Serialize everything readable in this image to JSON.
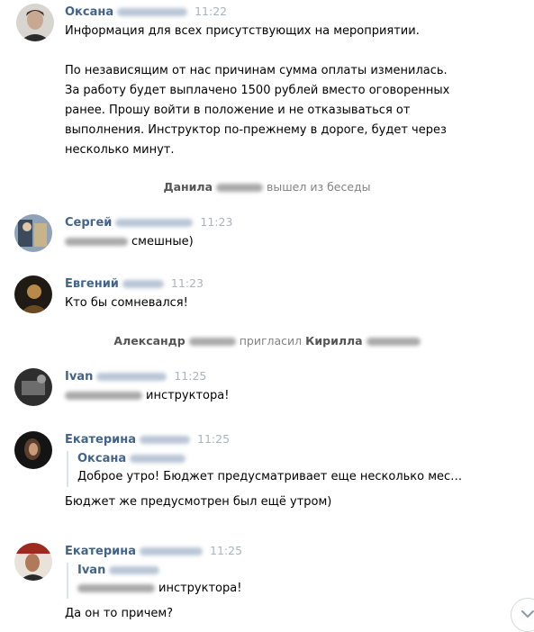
{
  "messages": [
    {
      "author": "Оксана",
      "time": "11:22",
      "lines": [
        "Информация для всех присутствующих на мероприятии.",
        "",
        "По независящим от нас причинам сумма оплаты изменилась.",
        "За работу будет выплачено 1500 рублей вместо оговоренных",
        "ранее. Прошу войти в положение и не отказываться от",
        "выполнения. Инструктор по-прежнему в дороге, будет через",
        "несколько минут."
      ]
    },
    {
      "author": "Сергей",
      "time": "11:23",
      "text": "смешные)"
    },
    {
      "author": "Евгений",
      "time": "11:23",
      "text": "Кто бы сомневался!"
    },
    {
      "author": "Ivan",
      "time": "11:25",
      "text": "инструктора!"
    },
    {
      "author": "Екатерина",
      "time": "11:25",
      "quote_author": "Оксана",
      "quote_text": "Доброе утро! Бюджет предусматривает еще несколько мес…",
      "text": "Бюджет же предусмотрен был ещё утром)"
    },
    {
      "author": "Екатерина",
      "time": "11:25",
      "quote_author": "Ivan",
      "quote_text": "инструктора!",
      "text": "Да он то причем?"
    }
  ],
  "service": [
    {
      "name": "Данила",
      "action": "вышел из беседы"
    },
    {
      "name": "Александр",
      "action": "пригласил",
      "target": "Кирилла"
    }
  ],
  "icons": {
    "scroll": "chevron-down-icon"
  },
  "colors": {
    "author": "#42648b",
    "time": "#a9b3bf",
    "service": "#828282"
  }
}
